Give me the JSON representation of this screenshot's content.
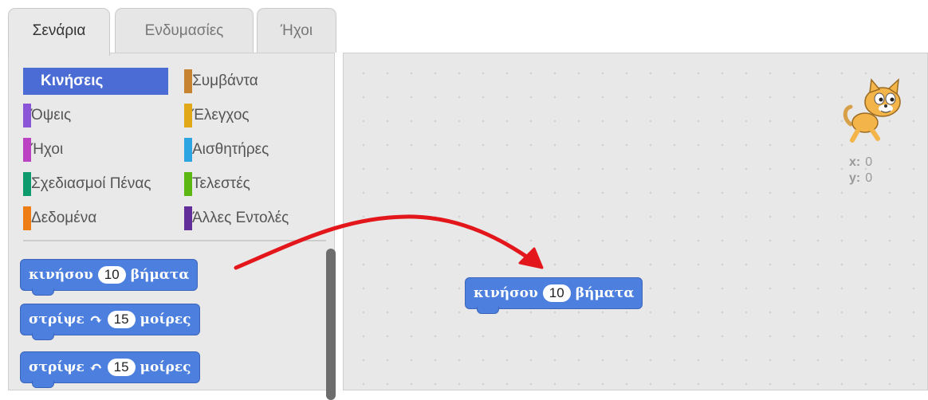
{
  "tabs": [
    {
      "label": "Σενάρια",
      "active": true
    },
    {
      "label": "Ενδυμασίες",
      "active": false
    },
    {
      "label": "Ήχοι",
      "active": false
    }
  ],
  "categories": [
    {
      "label": "Κινήσεις",
      "color": "#4a6cd4",
      "selected": true
    },
    {
      "label": "Συμβάντα",
      "color": "#c88330"
    },
    {
      "label": "Όψεις",
      "color": "#8a55d7"
    },
    {
      "label": "Έλεγχος",
      "color": "#e1a91a"
    },
    {
      "label": "Ήχοι",
      "color": "#bb42c3"
    },
    {
      "label": "Αισθητήρες",
      "color": "#2ca5e2"
    },
    {
      "label": "Σχεδιασμοί Πένας",
      "color": "#0e9a6c"
    },
    {
      "label": "Τελεστές",
      "color": "#5cb712"
    },
    {
      "label": "Δεδομένα",
      "color": "#ee7d16"
    },
    {
      "label": "Άλλες Εντολές",
      "color": "#632d99"
    }
  ],
  "palette_blocks": [
    {
      "pre": "κινήσου",
      "num": "10",
      "post": "βήματα"
    },
    {
      "pre": "στρίψε",
      "icon": "↷",
      "num": "15",
      "post": "μοίρες"
    },
    {
      "pre": "στρίψε",
      "icon": "↶",
      "num": "15",
      "post": "μοίρες"
    }
  ],
  "script_block": {
    "pre": "κινήσου",
    "num": "10",
    "post": "βήματα"
  },
  "sprite_info": {
    "x_label": "x:",
    "x_value": "0",
    "y_label": "y:",
    "y_value": "0"
  },
  "colors": {
    "motion_block": "#4c7fde",
    "arrow": "#e3161b"
  }
}
